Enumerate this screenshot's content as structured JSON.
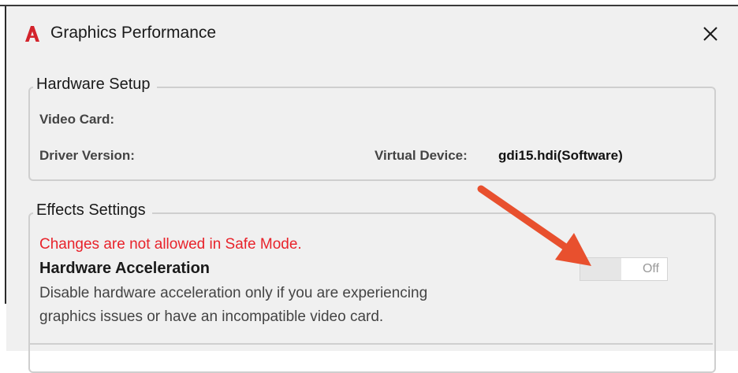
{
  "window": {
    "title": "Graphics Performance",
    "app_icon": "autocad-a-icon",
    "close_icon": "close-icon"
  },
  "hardware_setup": {
    "legend": "Hardware Setup",
    "video_card_label": "Video Card:",
    "driver_version_label": "Driver Version:",
    "virtual_device_label": "Virtual Device:",
    "virtual_device_value": "gdi15.hdi(Software)"
  },
  "effects_settings": {
    "legend": "Effects Settings",
    "warning": "Changes are not allowed in Safe Mode.",
    "hardware_acceleration_title": "Hardware Acceleration",
    "description_line1": "Disable hardware acceleration only if you are experiencing",
    "description_line2": "graphics issues or have an incompatible video card.",
    "toggle_state": "Off"
  },
  "colors": {
    "warning_text": "#e8232b",
    "annotation_arrow": "#e8502e",
    "app_icon_red": "#d3232b",
    "dialog_background": "#f0f0f0"
  },
  "icons": [
    "autocad-a-icon",
    "close-icon",
    "annotation-arrow-icon"
  ]
}
